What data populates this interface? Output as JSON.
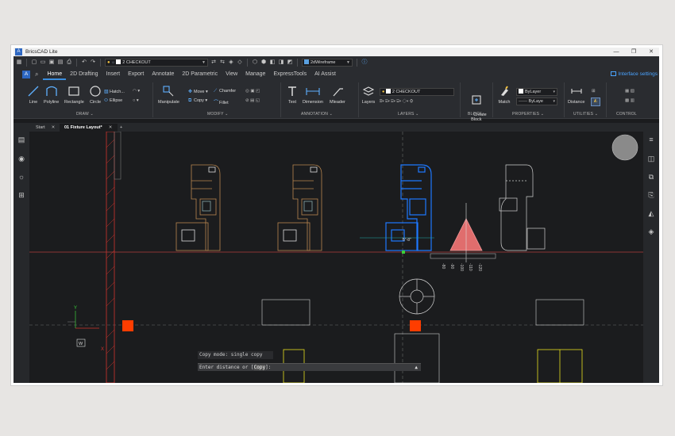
{
  "window": {
    "app_title": "BricsCAD Lite",
    "logo_letter": "A",
    "min_label": "—",
    "max_label": "❐",
    "close_label": "✕"
  },
  "quick_access": {
    "layer_value": "2 CHECKOUT",
    "visual_style_value": "2dWireframe",
    "icons": [
      "grid-icon",
      "save-icon",
      "print-icon",
      "undo-icon",
      "redo-icon"
    ]
  },
  "menu": {
    "tabs": [
      "Home",
      "2D Drafting",
      "Insert",
      "Export",
      "Annotate",
      "2D Parametric",
      "View",
      "Manage",
      "ExpressTools",
      "AI Assist"
    ],
    "active_tab": "Home",
    "interface_settings": "Interface settings"
  },
  "ribbon": {
    "draw": {
      "line": "Line",
      "polyline": "Polyline",
      "rectangle": "Rectangle",
      "circle": "Circle",
      "hatch": "Hatch...",
      "ellipse": "Ellipse",
      "panel": "DRAW"
    },
    "modify": {
      "manipulate": "Manipulate",
      "move": "Move",
      "copy": "Copy",
      "chamfer": "Chamfer",
      "fillet": "Fillet",
      "panel": "MODIFY"
    },
    "annotation": {
      "text": "Text",
      "dimension": "Dimension",
      "mleader": "Mleader",
      "panel": "ANNOTATION"
    },
    "layers": {
      "layers": "Layers",
      "current_layer": "2 CHECKOUT",
      "panel": "LAYERS"
    },
    "block": {
      "create_block": "Create\nBlock",
      "panel": "BLOCK"
    },
    "properties": {
      "match": "Match",
      "color": "ByLayer",
      "linetype": "ByLaye",
      "panel": "PROPERTIES"
    },
    "utilities": {
      "distance": "Distance",
      "panel": "UTILITIES"
    },
    "control": {
      "panel": "CONTROL"
    },
    "panel_arrow": "⌄"
  },
  "doc_tabs": [
    {
      "label": "Start",
      "close": "✕",
      "active": false
    },
    {
      "label": "01 Fixture Layout*",
      "close": "✕",
      "active": true
    }
  ],
  "new_tab": "+",
  "canvas": {
    "ucs_y": "Y",
    "ucs_x": "X",
    "ucs_w": "W",
    "ruler_ticks": [
      "-80",
      "-90",
      "-100",
      "-110",
      "-120"
    ],
    "dim_text": "5\"-8\""
  },
  "command_line": {
    "history": "Copy mode: single copy",
    "prompt_before": "Enter distance or [",
    "prompt_option": "Copy",
    "prompt_after": "]:",
    "expand_icon": "▲"
  },
  "colors": {
    "background": "#1b1c1e",
    "ribbon": "#2a2c30",
    "accent": "#3a8dde",
    "fixture_outline": "#b8864f",
    "selected_fixture": "#1e78ff",
    "grip": "#ff3d00",
    "red_wall": "#d0342c"
  }
}
